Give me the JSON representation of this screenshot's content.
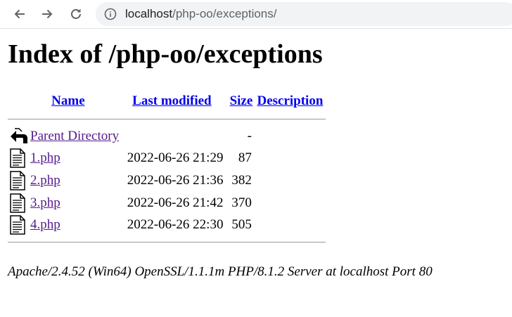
{
  "browser": {
    "url_host": "localhost",
    "url_path": "/php-oo/exceptions/"
  },
  "page": {
    "title": "Index of /php-oo/exceptions",
    "columns": {
      "name": "Name",
      "last_modified": "Last modified",
      "size": "Size",
      "description": "Description"
    },
    "parent": {
      "label": "Parent Directory",
      "size": "-"
    },
    "files": [
      {
        "name": "1.php",
        "modified": "2022-06-26 21:29",
        "size": "87"
      },
      {
        "name": "2.php",
        "modified": "2022-06-26 21:36",
        "size": "382"
      },
      {
        "name": "3.php",
        "modified": "2022-06-26 21:42",
        "size": "370"
      },
      {
        "name": "4.php",
        "modified": "2022-06-26 22:30",
        "size": "505"
      }
    ],
    "footer": "Apache/2.4.52 (Win64) OpenSSL/1.1.1m PHP/8.1.2 Server at localhost Port 80"
  },
  "icons": {
    "back": "arrow-left-icon",
    "forward": "arrow-right-icon",
    "reload": "reload-icon",
    "site_info": "info-icon",
    "parent": "parent-directory-icon",
    "file": "text-file-icon"
  }
}
